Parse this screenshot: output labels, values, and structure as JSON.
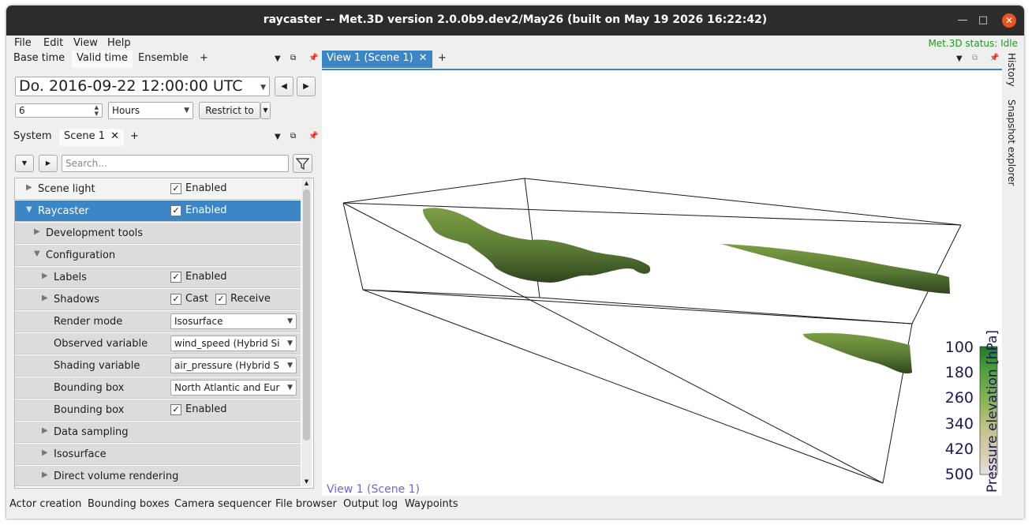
{
  "window": {
    "title": "raycaster -- Met.3D version 2.0.0b9.dev2/May26 (built on May 19 2026 16:22:42)"
  },
  "menu": {
    "file": "File",
    "edit": "Edit",
    "view": "View",
    "help": "Help",
    "status": "Met.3D status: Idle"
  },
  "time_panel": {
    "tabs": [
      "Base time",
      "Valid time",
      "Ensemble"
    ],
    "add": "+",
    "datetime": "Do. 2016-09-22 12:00:00 UTC",
    "step": "6",
    "unit": "Hours",
    "restrict_label": "Restrict to"
  },
  "scene_panel": {
    "tabs": [
      "System",
      "Scene 1"
    ],
    "add": "+",
    "search_placeholder": "Search..."
  },
  "properties": {
    "scene_light": {
      "label": "Scene light",
      "check": "Enabled"
    },
    "raycaster": {
      "label": "Raycaster",
      "check": "Enabled"
    },
    "dev_tools": "Development tools",
    "configuration": "Configuration",
    "labels": {
      "label": "Labels",
      "check": "Enabled"
    },
    "shadows": {
      "label": "Shadows",
      "cast": "Cast",
      "receive": "Receive"
    },
    "render_mode": {
      "label": "Render mode",
      "value": "Isosurface"
    },
    "observed_variable": {
      "label": "Observed variable",
      "value": "wind_speed (Hybrid Si"
    },
    "shading_variable": {
      "label": "Shading variable",
      "value": "air_pressure (Hybrid S"
    },
    "bounding_box_select": {
      "label": "Bounding box",
      "value": "North Atlantic and Eur"
    },
    "bounding_box_enable": {
      "label": "Bounding box",
      "check": "Enabled"
    },
    "data_sampling": "Data sampling",
    "isosurface": "Isosurface",
    "direct_volume_rendering": "Direct volume rendering"
  },
  "view": {
    "tab": "View 1 (Scene 1)",
    "add": "+",
    "label": "View 1 (Scene 1)",
    "legend": {
      "title": "Pressure elevation [hPa]",
      "ticks": [
        "100",
        "180",
        "260",
        "340",
        "420",
        "500"
      ],
      "colors": [
        "#1e7a2a",
        "#55a040",
        "#92b65a",
        "#c2c48a",
        "#d9cdb4",
        "#e8e2dc"
      ]
    }
  },
  "side_tabs": [
    "History",
    "Snapshot explorer"
  ],
  "bottom_tabs": [
    "Actor creation",
    "Bounding boxes",
    "Camera sequencer",
    "File browser",
    "Output log",
    "Waypoints"
  ],
  "colors": {
    "selection": "#3d86c6",
    "status": "#1e9a1e",
    "isosurface": "#5a7a34"
  }
}
